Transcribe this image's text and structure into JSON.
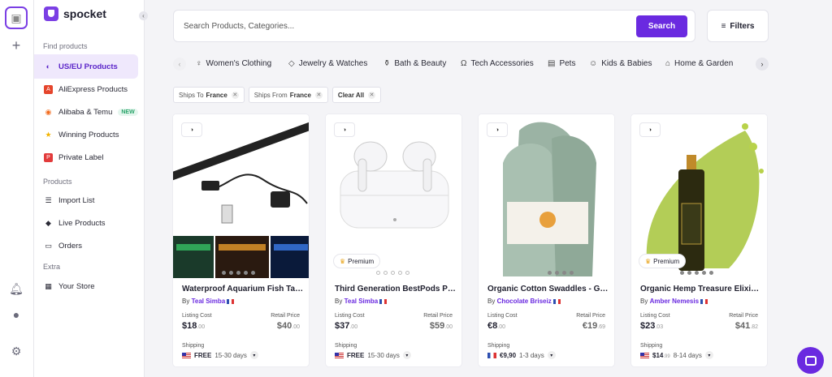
{
  "app": {
    "name": "spocket"
  },
  "sidebar": {
    "sections": [
      "Find products",
      "Products",
      "Extra"
    ],
    "items": [
      {
        "label": "US/EU Products",
        "icon": "eu-us-flag-icon"
      },
      {
        "label": "AliExpress Products",
        "icon": "aliexpress-icon"
      },
      {
        "label": "Alibaba & Temu",
        "icon": "alibaba-icon",
        "badge": "NEW"
      },
      {
        "label": "Winning Products",
        "icon": "star-icon"
      },
      {
        "label": "Private Label",
        "icon": "private-label-icon"
      },
      {
        "label": "Import List",
        "icon": "list-icon"
      },
      {
        "label": "Live Products",
        "icon": "tag-icon"
      },
      {
        "label": "Orders",
        "icon": "cart-icon"
      },
      {
        "label": "Your Store",
        "icon": "store-icon"
      }
    ]
  },
  "search": {
    "placeholder": "Search Products, Categories...",
    "button": "Search"
  },
  "filters": {
    "label": "Filters"
  },
  "categories": [
    "Women's Clothing",
    "Jewelry & Watches",
    "Bath & Beauty",
    "Tech Accessories",
    "Pets",
    "Kids & Babies",
    "Home & Garden"
  ],
  "chips": [
    {
      "prefix": "Ships To",
      "value": "France"
    },
    {
      "prefix": "Ships From",
      "value": "France"
    },
    {
      "prefix": "Clear All",
      "value": ""
    }
  ],
  "cards": [
    {
      "title": "Waterproof Aquarium Fish Tan...",
      "by": "By",
      "supplier": "Teal Simba",
      "listing_label": "Listing Cost",
      "listing_main": "$18",
      "listing_cents": ".00",
      "retail_label": "Retail Price",
      "retail_main": "$40",
      "retail_cents": ".00",
      "shipping_label": "Shipping",
      "ship_value": "FREE",
      "ship_days": "15-30 days",
      "premium": ""
    },
    {
      "title": "Third Generation BestPods Pr...",
      "by": "By",
      "supplier": "Teal Simba",
      "listing_label": "Listing Cost",
      "listing_main": "$37",
      "listing_cents": ".00",
      "retail_label": "Retail Price",
      "retail_main": "$59",
      "retail_cents": ".00",
      "shipping_label": "Shipping",
      "ship_value": "FREE",
      "ship_days": "15-30 days",
      "premium": "Premium"
    },
    {
      "title": "Organic Cotton Swaddles - Gr...",
      "by": "By",
      "supplier": "Chocolate Briseiz",
      "listing_label": "Listing Cost",
      "listing_main": "€8",
      "listing_cents": ".00",
      "retail_label": "Retail Price",
      "retail_main": "€19",
      "retail_cents": ".69",
      "shipping_label": "Shipping",
      "ship_value": "€9,90",
      "ship_days": "1-3 days",
      "premium": ""
    },
    {
      "title": "Organic Hemp Treasure Elixir ...",
      "by": "By",
      "supplier": "Amber Nemesis",
      "listing_label": "Listing Cost",
      "listing_main": "$23",
      "listing_cents": ".03",
      "retail_label": "Retail Price",
      "retail_main": "$41",
      "retail_cents": ".82",
      "shipping_label": "Shipping",
      "ship_value": "$14",
      "ship_days": "8-14 days",
      "ship_cents": ".99",
      "premium": "Premium"
    }
  ],
  "colors": {
    "accent": "#6a2ae0",
    "active_bg": "#efe8fc"
  }
}
